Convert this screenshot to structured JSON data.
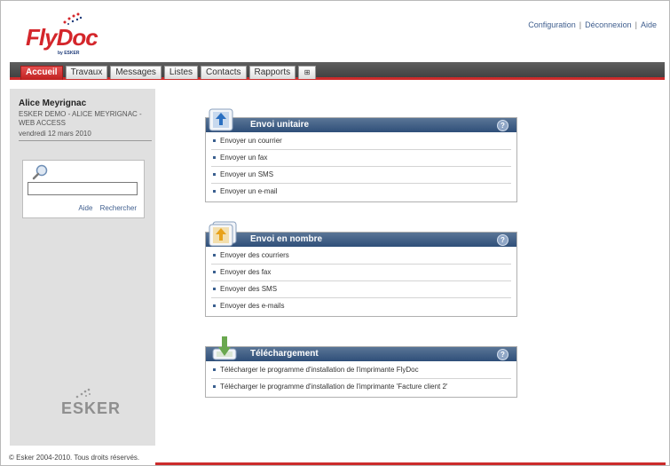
{
  "app": {
    "logo_text": "FlyDoc",
    "logo_sub": "by ESKER"
  },
  "toplinks": {
    "configuration": "Configuration",
    "logout": "Déconnexion",
    "help": "Aide",
    "separator": "|"
  },
  "tabs": [
    {
      "label": "Accueil",
      "active": true
    },
    {
      "label": "Travaux",
      "active": false
    },
    {
      "label": "Messages",
      "active": false
    },
    {
      "label": "Listes",
      "active": false
    },
    {
      "label": "Contacts",
      "active": false
    },
    {
      "label": "Rapports",
      "active": false
    },
    {
      "label": "⊞",
      "active": false
    }
  ],
  "user": {
    "name": "Alice Meyrignac",
    "company": "ESKER DEMO - ALICE MEYRIGNAC - WEB ACCESS",
    "date": "vendredi 12 mars 2010"
  },
  "search": {
    "value": "",
    "help_link": "Aide",
    "search_link": "Rechercher"
  },
  "sidebar_logo": "ESKER",
  "footer": "© Esker 2004-2010. Tous droits réservés.",
  "panels": {
    "single": {
      "title": "Envoi unitaire",
      "items": [
        "Envoyer un courrier",
        "Envoyer un fax",
        "Envoyer un SMS",
        "Envoyer un e-mail"
      ]
    },
    "bulk": {
      "title": "Envoi en nombre",
      "items": [
        "Envoyer des courriers",
        "Envoyer des fax",
        "Envoyer des SMS",
        "Envoyer des e-mails"
      ]
    },
    "download": {
      "title": "Téléchargement",
      "items": [
        "Télécharger le programme d'installation de l'imprimante FlyDoc",
        "Télécharger le programme d'installation de l'imprimante 'Facture client 2'"
      ]
    }
  },
  "colors": {
    "brand_red": "#cc2b2b",
    "panel_header": "#2f4f79",
    "link_blue": "#3f5e8e"
  },
  "icons": {
    "help": "help-icon",
    "search": "magnifier-icon",
    "upload": "upload-document-icon",
    "bulk": "bulk-documents-icon",
    "download": "download-icon"
  }
}
